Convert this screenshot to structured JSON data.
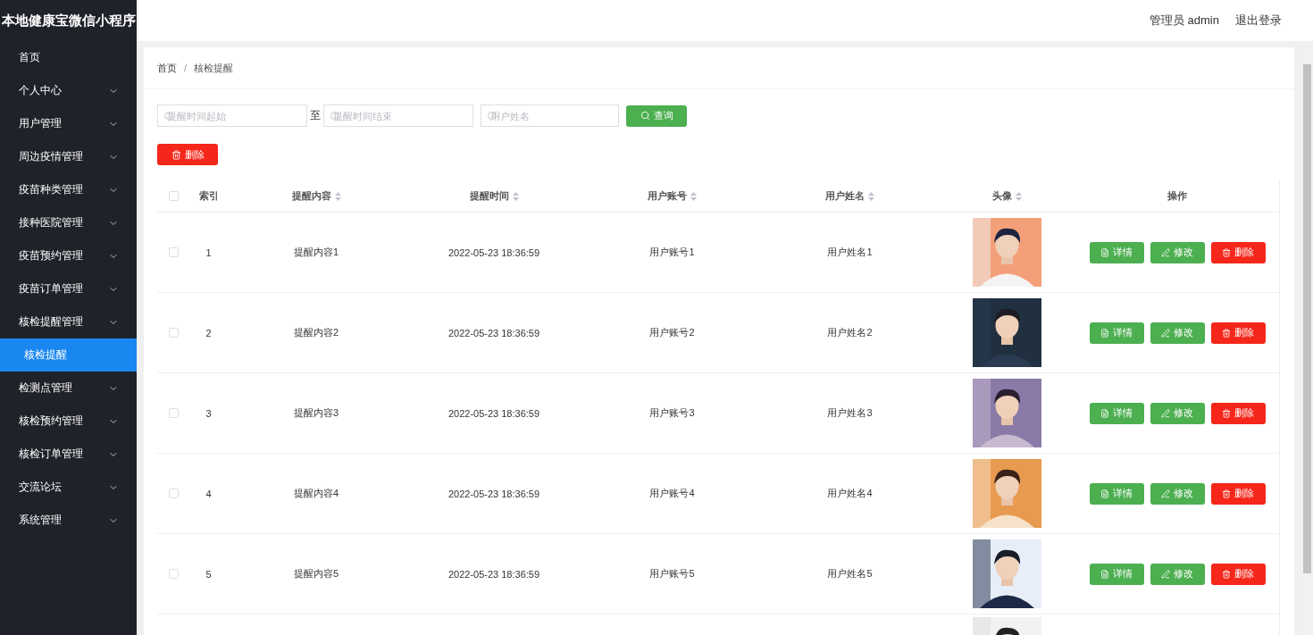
{
  "app_title": "本地健康宝微信小程序",
  "sidebar": {
    "items": [
      {
        "label": "首页",
        "expandable": false
      },
      {
        "label": "个人中心",
        "expandable": true,
        "expanded": false
      },
      {
        "label": "用户管理",
        "expandable": true,
        "expanded": false
      },
      {
        "label": "周边疫情管理",
        "expandable": true,
        "expanded": false
      },
      {
        "label": "疫苗种类管理",
        "expandable": true,
        "expanded": false
      },
      {
        "label": "接种医院管理",
        "expandable": true,
        "expanded": false
      },
      {
        "label": "疫苗预约管理",
        "expandable": true,
        "expanded": false
      },
      {
        "label": "疫苗订单管理",
        "expandable": true,
        "expanded": false
      },
      {
        "label": "核检提醒管理",
        "expandable": true,
        "expanded": true,
        "children": [
          {
            "label": "核检提醒",
            "selected": true
          }
        ]
      },
      {
        "label": "检测点管理",
        "expandable": true,
        "expanded": false
      },
      {
        "label": "核检预约管理",
        "expandable": true,
        "expanded": false
      },
      {
        "label": "核检订单管理",
        "expandable": true,
        "expanded": false
      },
      {
        "label": "交流论坛",
        "expandable": true,
        "expanded": false
      },
      {
        "label": "系统管理",
        "expandable": true,
        "expanded": false
      }
    ]
  },
  "header": {
    "user": "管理员 admin",
    "logout": "退出登录"
  },
  "breadcrumb": {
    "items": [
      "首页",
      "核检提醒"
    ],
    "separator": "/"
  },
  "filters": {
    "start": {
      "placeholder": "提醒时间起始"
    },
    "separator": "至",
    "end": {
      "placeholder": "提醒时间结束"
    },
    "name": {
      "placeholder": "用户姓名"
    },
    "search_button": "查询"
  },
  "bulk_delete": "删除",
  "table": {
    "select_all_checked": false,
    "columns": [
      {
        "label": "索引",
        "sortable": false
      },
      {
        "label": "提醒内容",
        "sortable": true
      },
      {
        "label": "提醒时间",
        "sortable": true
      },
      {
        "label": "用户账号",
        "sortable": true
      },
      {
        "label": "用户姓名",
        "sortable": true
      },
      {
        "label": "头像",
        "sortable": true
      },
      {
        "label": "操作",
        "sortable": false
      }
    ],
    "rows": [
      {
        "kind": "full",
        "checked": false,
        "index": "1",
        "content": "提醒内容1",
        "time": "2022-05-23 18:36:59",
        "account": "用户账号1",
        "name": "用户姓名1",
        "actions": [
          "详情",
          "修改",
          "删除"
        ]
      },
      {
        "kind": "full",
        "checked": false,
        "index": "2",
        "content": "提醒内容2",
        "time": "2022-05-23 18:36:59",
        "account": "用户账号2",
        "name": "用户姓名2",
        "actions": [
          "详情",
          "修改",
          "删除"
        ]
      },
      {
        "kind": "full",
        "checked": false,
        "index": "3",
        "content": "提醒内容3",
        "time": "2022-05-23 18:36:59",
        "account": "用户账号3",
        "name": "用户姓名3",
        "actions": [
          "详情",
          "修改",
          "删除"
        ]
      },
      {
        "kind": "full",
        "checked": false,
        "index": "4",
        "content": "提醒内容4",
        "time": "2022-05-23 18:36:59",
        "account": "用户账号4",
        "name": "用户姓名4",
        "actions": [
          "详情",
          "修改",
          "删除"
        ]
      },
      {
        "kind": "full",
        "checked": false,
        "index": "5",
        "content": "提醒内容5",
        "time": "2022-05-23 18:36:59",
        "account": "用户账号5",
        "name": "用户姓名5",
        "actions": [
          "详情",
          "修改",
          "删除"
        ]
      },
      {
        "kind": "partial"
      }
    ]
  }
}
